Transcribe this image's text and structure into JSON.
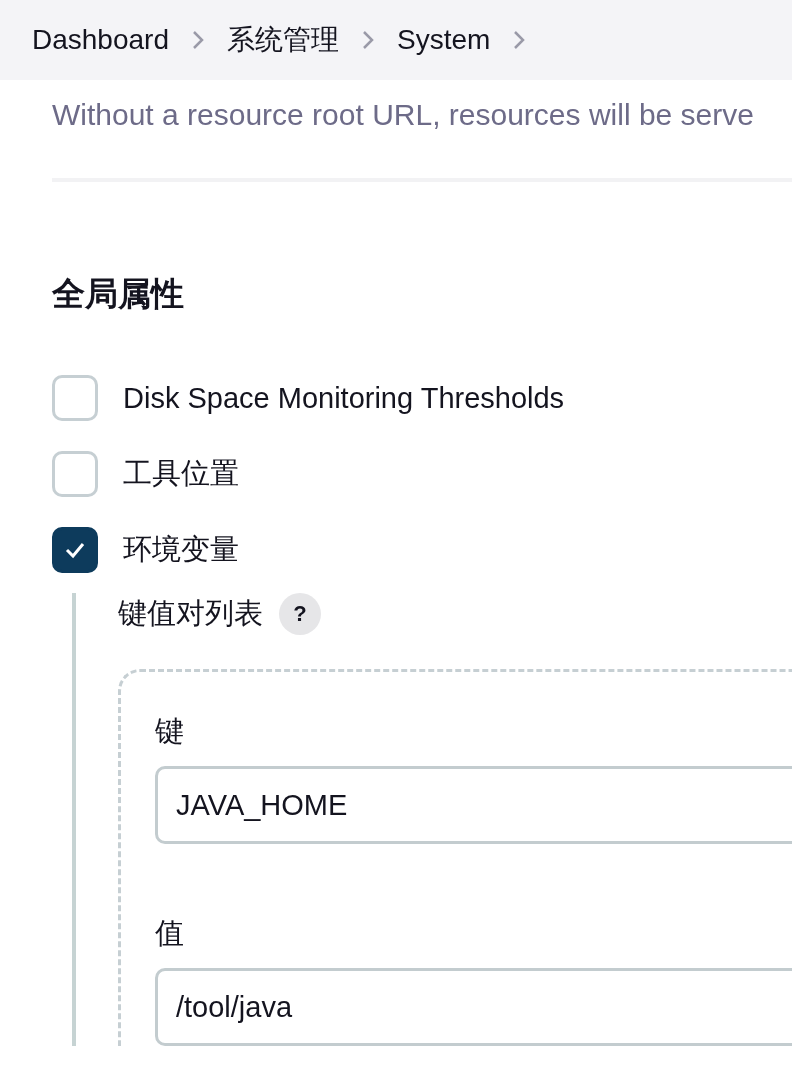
{
  "breadcrumbs": [
    {
      "label": "Dashboard"
    },
    {
      "label": "系统管理"
    },
    {
      "label": "System"
    }
  ],
  "description": "Without a resource root URL, resources will be serve",
  "section": {
    "title": "全局属性",
    "options": [
      {
        "label": "Disk Space Monitoring Thresholds",
        "checked": false
      },
      {
        "label": "工具位置",
        "checked": false
      },
      {
        "label": "环境变量",
        "checked": true,
        "panel": {
          "label": "键值对列表",
          "help": "?",
          "fields": [
            {
              "label": "键",
              "value": "JAVA_HOME"
            },
            {
              "label": "值",
              "value": "/tool/java"
            }
          ]
        }
      }
    ]
  }
}
